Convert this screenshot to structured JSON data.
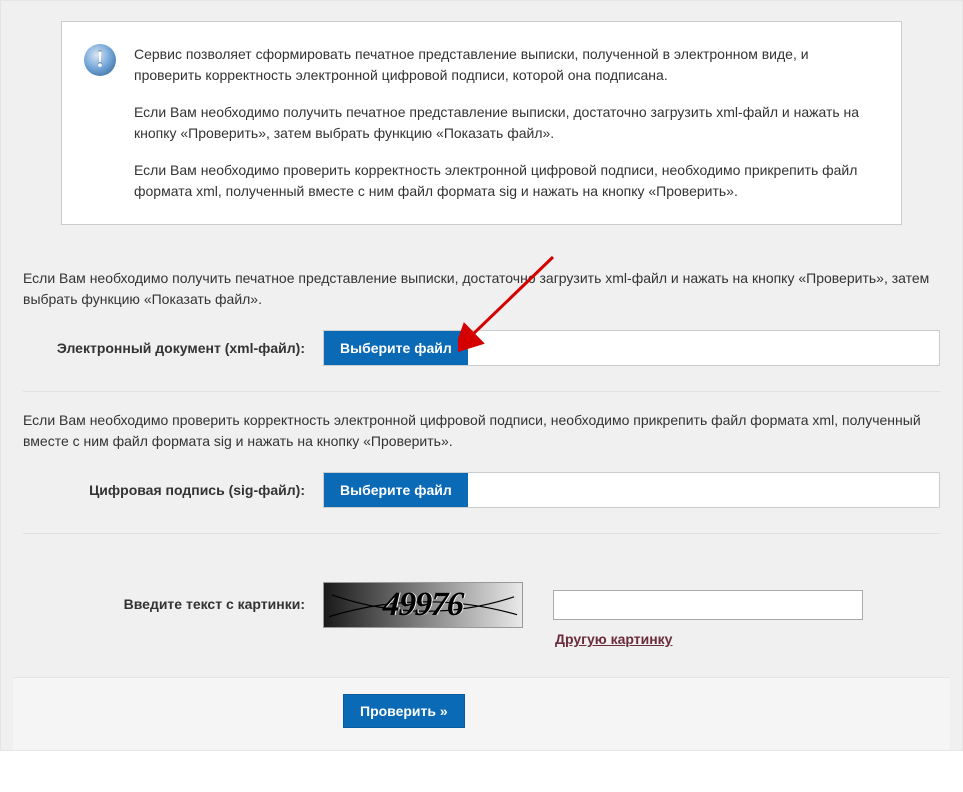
{
  "info": {
    "p1": "Сервис позволяет сформировать печатное представление выписки, полученной в электронном виде, и проверить корректность электронной цифровой подписи, которой она подписана.",
    "p2": "Если Вам необходимо получить печатное представление выписки, достаточно загрузить xml-файл и нажать на кнопку «Проверить», затем выбрать функцию «Показать файл».",
    "p3": "Если Вам необходимо проверить корректность электронной цифровой подписи, необходимо прикрепить файл формата xml, полученный вместе с ним файл формата sig и нажать на кнопку «Проверить»."
  },
  "xml": {
    "note": "Если Вам необходимо получить печатное представление выписки, достаточно загрузить xml-файл и нажать на кнопку «Проверить», затем выбрать функцию «Показать файл».",
    "label": "Электронный документ (xml-файл):",
    "button": "Выберите файл",
    "value": ""
  },
  "sig": {
    "note": "Если Вам необходимо проверить корректность электронной цифровой подписи, необходимо прикрепить файл формата xml, полученный вместе с ним файл формата sig и нажать на кнопку «Проверить».",
    "label": "Цифровая подпись (sig-файл):",
    "button": "Выберите файл",
    "value": ""
  },
  "captcha": {
    "label": "Введите текст с картинки:",
    "image_text": "49976",
    "input_value": "",
    "refresh_link": "Другую картинку"
  },
  "submit": {
    "label": "Проверить »"
  },
  "icon_glyph": "!"
}
